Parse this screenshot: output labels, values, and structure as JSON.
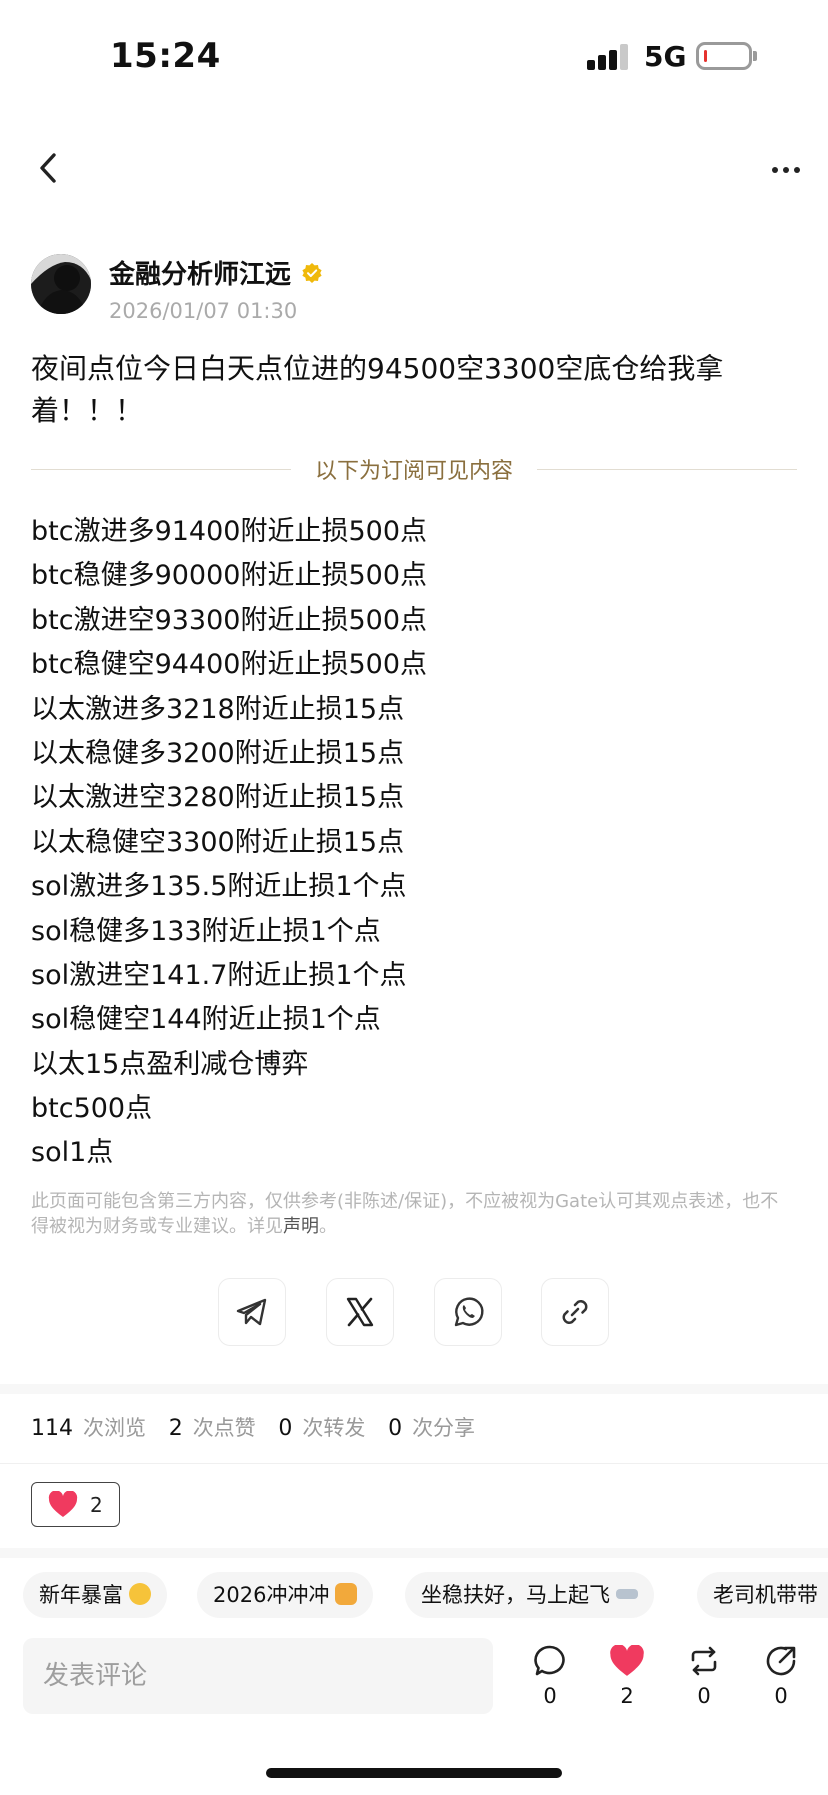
{
  "status_bar": {
    "time": "15:24",
    "network": "5G",
    "battery_level": 0.08,
    "battery_color": "#e5322e"
  },
  "nav": {
    "back_icon": "chevron-left-icon",
    "more_icon": "more-horizontal-icon"
  },
  "author": {
    "name": "金融分析师江远",
    "verified_color": "#f0b90b",
    "date": "2026/01/07 01:30"
  },
  "post": {
    "intro": "夜间点位今日白天点位进的94500空3300空底仓给我拿着！！！",
    "subscriber_divider": "以下为订阅可见内容",
    "lines": [
      "btc激进多91400附近止损500点",
      "btc稳健多90000附近止损500点",
      "btc激进空93300附近止损500点",
      "btc稳健空94400附近止损500点",
      "以太激进多3218附近止损15点",
      "以太稳健多3200附近止损15点",
      "以太激进空3280附近止损15点",
      "以太稳健空3300附近止损15点",
      "sol激进多135.5附近止损1个点",
      "sol稳健多133附近止损1个点",
      "sol激进空141.7附近止损1个点",
      "sol稳健空144附近止损1个点",
      "以太15点盈利减仓博弈",
      "btc500点",
      "sol1点"
    ],
    "disclaimer": "此页面可能包含第三方内容，仅供参考(非陈述/保证)，不应被视为Gate认可其观点表述，也不得被视为财务或专业建议。详见",
    "disclaimer_link": "声明",
    "disclaimer_end": "。"
  },
  "share": {
    "icons": [
      "telegram-icon",
      "x-icon",
      "whatsapp-icon",
      "link-icon"
    ]
  },
  "stats": {
    "views": "114",
    "views_label": "次浏览",
    "likes": "2",
    "likes_label": "次点赞",
    "reposts": "0",
    "reposts_label": "次转发",
    "shares": "0",
    "shares_label": "次分享"
  },
  "reaction": {
    "icon": "heart-icon",
    "count": "2",
    "color": "#f03a5f"
  },
  "chips": [
    {
      "text": "新年暴富",
      "emoji": "money-mouth-face"
    },
    {
      "text": "2026冲冲冲",
      "emoji": "oncoming-fist"
    },
    {
      "text": "坐稳扶好，马上起飞",
      "emoji": "airplane"
    },
    {
      "text": "老司机带带",
      "emoji": ""
    }
  ],
  "comment_bar": {
    "placeholder": "发表评论",
    "comments": "0",
    "likes": "2",
    "reposts": "0",
    "shares": "0"
  }
}
